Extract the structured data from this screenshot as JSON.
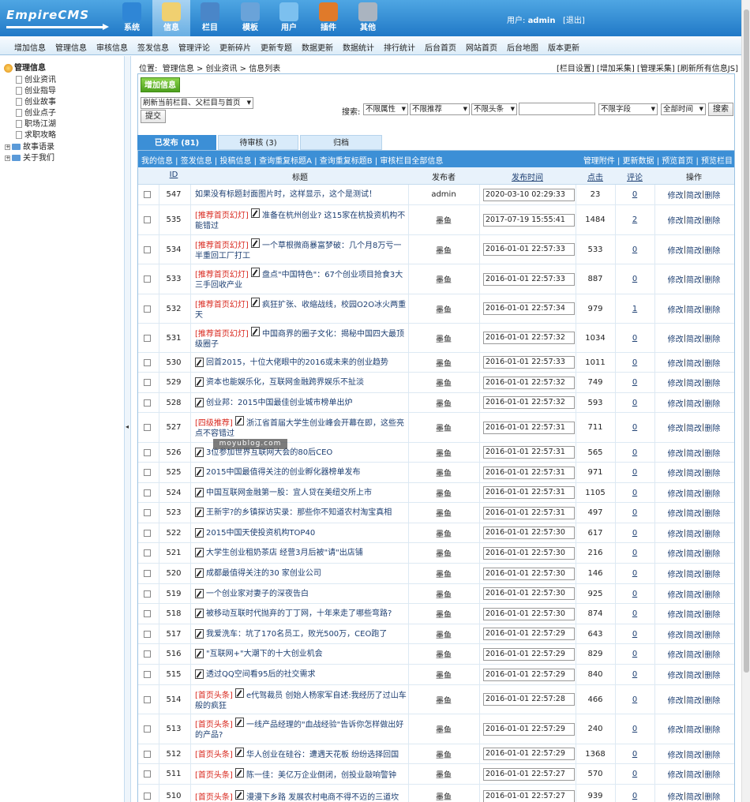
{
  "brand": {
    "logo": "EmpireCMS"
  },
  "topnav": [
    {
      "label": "系统",
      "icon": "globe-icon",
      "color": "#2f86d6"
    },
    {
      "label": "信息",
      "icon": "notepad-icon",
      "color": "#f0d070"
    },
    {
      "label": "栏目",
      "icon": "folder-icon",
      "color": "#4a86c8"
    },
    {
      "label": "模板",
      "icon": "template-icon",
      "color": "#6aa3d9"
    },
    {
      "label": "用户",
      "icon": "user-icon",
      "color": "#7cc0ef"
    },
    {
      "label": "插件",
      "icon": "tools-icon",
      "color": "#e07a2a"
    },
    {
      "label": "其他",
      "icon": "gear-icon",
      "color": "#aab4c0"
    }
  ],
  "user": {
    "prefix": "用户:",
    "name": "admin",
    "logout": "[退出]"
  },
  "menubar": [
    "增加信息",
    "管理信息",
    "审核信息",
    "签发信息",
    "管理评论",
    "更新碎片",
    "更新专题",
    "数据更新",
    "数据统计",
    "排行统计",
    "后台首页",
    "网站首页",
    "后台地图",
    "版本更新"
  ],
  "sidebar": {
    "root": "管理信息",
    "items": [
      "创业资讯",
      "创业指导",
      "创业故事",
      "创业点子",
      "职场江湖",
      "求职攻略"
    ],
    "folders": [
      "故事语录",
      "关于我们"
    ]
  },
  "crumb": {
    "label": "位置:",
    "parts": [
      "管理信息",
      "创业资讯",
      "信息列表"
    ],
    "sep": " > "
  },
  "toplinks": "[栏目设置] [增加采集] [管理采集] [刷新所有信息JS]",
  "toolbar": {
    "add": "增加信息",
    "refresh_select": "刷新当前栏目、父栏目与首页",
    "submit": "提交",
    "search_label": "搜索:",
    "filters": [
      "不限属性",
      "不限推荐",
      "不限头条"
    ],
    "keyword": "",
    "field": "不限字段",
    "time": "全部时间",
    "search": "搜索"
  },
  "tabs": [
    "已发布 (81)",
    "待审核 (3)",
    "归档"
  ],
  "linkbar": {
    "left": "我的信息 | 签发信息 | 投稿信息 | 查询重复标题A | 查询重复标题B | 审核栏目全部信息",
    "right": "管理附件 | 更新数据 | 预览首页 | 预览栏目"
  },
  "columns": {
    "id": "ID",
    "title": "标题",
    "author": "发布者",
    "time": "发布时间",
    "clicks": "点击",
    "comments": "评论",
    "ops": "操作"
  },
  "ops": {
    "edit": "修改",
    "simple": "简改",
    "del": "删除",
    "sep": " | "
  },
  "rows": [
    {
      "id": "547",
      "tag": "",
      "title": "如果没有标题封面图片时，这样显示，这个是测试！",
      "icon": false,
      "author": "admin",
      "time": "2020-03-10 02:29:33",
      "clicks": "23",
      "comments": "0",
      "h": 26
    },
    {
      "id": "535",
      "tag": "[推荐首页幻灯]",
      "title": "准备在杭州创业? 这15家在杭投资机构不能错过",
      "icon": true,
      "author": "墨鱼",
      "time": "2017-07-19 15:55:41",
      "clicks": "1484",
      "comments": "2",
      "h": 38
    },
    {
      "id": "534",
      "tag": "[推荐首页幻灯]",
      "title": "一个草根微商暴富梦破：几个月8万亏一半重回工厂打工",
      "icon": true,
      "author": "墨鱼",
      "time": "2016-01-01 22:57:33",
      "clicks": "533",
      "comments": "0",
      "h": 37
    },
    {
      "id": "533",
      "tag": "[推荐首页幻灯]",
      "title": "盘点\"中国特色\"：67个创业项目抢食3大三手回收产业",
      "icon": true,
      "author": "墨鱼",
      "time": "2016-01-01 22:57:33",
      "clicks": "887",
      "comments": "0",
      "h": 38
    },
    {
      "id": "532",
      "tag": "[推荐首页幻灯]",
      "title": "疯狂扩张、收缩战线，校园O2O冰火两重天",
      "icon": true,
      "author": "墨鱼",
      "time": "2016-01-01 22:57:34",
      "clicks": "979",
      "comments": "1",
      "h": 37
    },
    {
      "id": "531",
      "tag": "[推荐首页幻灯]",
      "title": "中国商界的圈子文化：揭秘中国四大最顶级圈子",
      "icon": true,
      "author": "墨鱼",
      "time": "2016-01-01 22:57:32",
      "clicks": "1034",
      "comments": "0",
      "h": 37
    },
    {
      "id": "530",
      "tag": "",
      "title": "回首2015，十位大佬眼中的2016或未来的创业趋势",
      "icon": true,
      "author": "墨鱼",
      "time": "2016-01-01 22:57:33",
      "clicks": "1011",
      "comments": "0",
      "h": 25
    },
    {
      "id": "529",
      "tag": "",
      "title": "资本也能娱乐化，互联网金融跨界娱乐不扯淡",
      "icon": true,
      "author": "墨鱼",
      "time": "2016-01-01 22:57:32",
      "clicks": "749",
      "comments": "0",
      "h": 26
    },
    {
      "id": "528",
      "tag": "",
      "title": "创业邦：2015中国最佳创业城市榜单出炉",
      "icon": true,
      "author": "墨鱼",
      "time": "2016-01-01 22:57:32",
      "clicks": "593",
      "comments": "0",
      "h": 25
    },
    {
      "id": "527",
      "tag": "[四级推荐]",
      "title": "浙江省首届大学生创业峰会开幕在即，这些亮点不容错过",
      "icon": true,
      "author": "墨鱼",
      "time": "2016-01-01 22:57:31",
      "clicks": "711",
      "comments": "0",
      "h": 38
    },
    {
      "id": "526",
      "tag": "",
      "title": "3位参加世界互联网大会的80后CEO",
      "icon": true,
      "author": "墨鱼",
      "time": "2016-01-01 22:57:31",
      "clicks": "565",
      "comments": "0",
      "h": 25
    },
    {
      "id": "525",
      "tag": "",
      "title": "2015中国最值得关注的创业孵化器榜单发布",
      "icon": true,
      "author": "墨鱼",
      "time": "2016-01-01 22:57:31",
      "clicks": "971",
      "comments": "0",
      "h": 26
    },
    {
      "id": "524",
      "tag": "",
      "title": "中国互联网金融第一股：宜人贷在美纽交所上市",
      "icon": true,
      "author": "墨鱼",
      "time": "2016-01-01 22:57:31",
      "clicks": "1105",
      "comments": "0",
      "h": 25
    },
    {
      "id": "523",
      "tag": "",
      "title": "王新宇?的乡镇探访实录：那些你不知道农村淘宝真相",
      "icon": true,
      "author": "墨鱼",
      "time": "2016-01-01 22:57:31",
      "clicks": "497",
      "comments": "0",
      "h": 26
    },
    {
      "id": "522",
      "tag": "",
      "title": "2015中国天使投资机构TOP40",
      "icon": true,
      "author": "墨鱼",
      "time": "2016-01-01 22:57:30",
      "clicks": "617",
      "comments": "0",
      "h": 25
    },
    {
      "id": "521",
      "tag": "",
      "title": "大学生创业租奶茶店 经营3月后被\"请\"出店铺",
      "icon": true,
      "author": "墨鱼",
      "time": "2016-01-01 22:57:30",
      "clicks": "216",
      "comments": "0",
      "h": 26
    },
    {
      "id": "520",
      "tag": "",
      "title": "成都最值得关注的30 家创业公司",
      "icon": true,
      "author": "墨鱼",
      "time": "2016-01-01 22:57:30",
      "clicks": "146",
      "comments": "0",
      "h": 26
    },
    {
      "id": "519",
      "tag": "",
      "title": "一个创业家对妻子的深夜告白",
      "icon": true,
      "author": "墨鱼",
      "time": "2016-01-01 22:57:30",
      "clicks": "925",
      "comments": "0",
      "h": 25
    },
    {
      "id": "518",
      "tag": "",
      "title": "被移动互联时代抛弃的丁丁网，十年来走了哪些弯路?",
      "icon": true,
      "author": "墨鱼",
      "time": "2016-01-01 22:57:30",
      "clicks": "874",
      "comments": "0",
      "h": 26
    },
    {
      "id": "517",
      "tag": "",
      "title": "我爱洗车：坑了170名员工，败光500万，CEO跑了",
      "icon": true,
      "author": "墨鱼",
      "time": "2016-01-01 22:57:29",
      "clicks": "643",
      "comments": "0",
      "h": 25
    },
    {
      "id": "516",
      "tag": "",
      "title": "\"互联网+\"大潮下的十大创业机会",
      "icon": true,
      "author": "墨鱼",
      "time": "2016-01-01 22:57:29",
      "clicks": "829",
      "comments": "0",
      "h": 26
    },
    {
      "id": "515",
      "tag": "",
      "title": "透过QQ空间看95后的社交需求",
      "icon": true,
      "author": "墨鱼",
      "time": "2016-01-01 22:57:29",
      "clicks": "840",
      "comments": "0",
      "h": 26
    },
    {
      "id": "514",
      "tag": "[首页头条]",
      "title": "e代驾裁员 创始人杨家军自述:我经历了过山车般的疯狂",
      "icon": true,
      "author": "墨鱼",
      "time": "2016-01-01 22:57:28",
      "clicks": "466",
      "comments": "0",
      "h": 37
    },
    {
      "id": "513",
      "tag": "[首页头条]",
      "title": "一线产品经理的\"血战经验\"告诉你怎样做出好的产品?",
      "icon": true,
      "author": "墨鱼",
      "time": "2016-01-01 22:57:29",
      "clicks": "240",
      "comments": "0",
      "h": 38
    },
    {
      "id": "512",
      "tag": "[首页头条]",
      "title": "华人创业在硅谷：遭遇天花板 纷纷选择回国",
      "icon": true,
      "author": "墨鱼",
      "time": "2016-01-01 22:57:29",
      "clicks": "1368",
      "comments": "0",
      "h": 25
    },
    {
      "id": "511",
      "tag": "[首页头条]",
      "title": "陈一佳：美亿万企业倒闭，创投业敲响警钟",
      "icon": true,
      "author": "墨鱼",
      "time": "2016-01-01 22:57:27",
      "clicks": "570",
      "comments": "0",
      "h": 26
    },
    {
      "id": "510",
      "tag": "[首页头条]",
      "title": "漫漫下乡路 发展农村电商不得不迈的三道坎",
      "icon": true,
      "author": "墨鱼",
      "time": "2016-01-01 22:57:27",
      "clicks": "939",
      "comments": "0",
      "h": 30
    }
  ],
  "watermark": "moyublog.com"
}
